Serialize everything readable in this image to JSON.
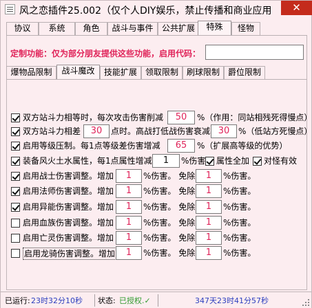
{
  "window": {
    "title": "风之恋插件25.002（仅个人DIY娱乐，禁止传播和商业应用",
    "close_glyph": "✕"
  },
  "tabs_top": [
    {
      "label": "协议"
    },
    {
      "label": "系统"
    },
    {
      "label": "角色"
    },
    {
      "label": "战斗与事件"
    },
    {
      "label": "公共扩展"
    },
    {
      "label": "特殊"
    },
    {
      "label": "怪物"
    }
  ],
  "custom": {
    "label": "定制功能：仅为部分朋友提供这些功能，启用代码：",
    "code_value": ""
  },
  "tabs_sub": [
    {
      "label": "爆物品限制"
    },
    {
      "label": "战斗魔改"
    },
    {
      "label": "技能扩展"
    },
    {
      "label": "领取限制"
    },
    {
      "label": "刷球限制"
    },
    {
      "label": "爵位限制"
    }
  ],
  "rows": {
    "r1": {
      "a": "双方站斗力相等时，每次攻击伤害削减",
      "v": "50",
      "b": "%（作用：同站相残死得慢点）"
    },
    "r2": {
      "a": "双方站斗力相差",
      "v1": "30",
      "b": "点时。高战打低战伤害衰减",
      "v2": "30",
      "c": "%（低站方死慢点）"
    },
    "r3": {
      "a": "启用等级压制。每1点等级差伤害增减",
      "v": "65",
      "b": "%（扩展高等级的优势）"
    },
    "r4": {
      "a": "装备风火土水属性，每1点属性增减",
      "v": "1",
      "b": "%伤害",
      "c": "属性全加",
      "d": "对怪有效"
    },
    "r5": {
      "a": "启用战士伤害调整。增加",
      "v1": "1",
      "b": "%伤害。  免除",
      "v2": "1",
      "c": "%伤害。"
    },
    "r6": {
      "a": "启用法师伤害调整。增加",
      "v1": "1",
      "b": "%伤害。  免除",
      "v2": "1",
      "c": "%伤害。"
    },
    "r7": {
      "a": "启用异能伤害调整。增加",
      "v1": "1",
      "b": "%伤害。  免除",
      "v2": "1",
      "c": "%伤害。"
    },
    "r8": {
      "a": "启用血族伤害调整。增加",
      "v1": "1",
      "b": "%伤害。  免除",
      "v2": "1",
      "c": "%伤害。"
    },
    "r9": {
      "a": "启用亡灵伤害调整。增加",
      "v1": "1",
      "b": "%伤害。  免除",
      "v2": "1",
      "c": "%伤害。"
    },
    "r10": {
      "a": "启用龙骑伤害调整。增加",
      "v1": "1",
      "b": "%伤害。  免除",
      "v2": "1",
      "c": "%伤害。"
    }
  },
  "status": {
    "run_label": "已运行:",
    "run_value": "23时32分10秒",
    "state_label": "状态:",
    "state_value": "已授权.✓",
    "remaining": "347天23时41分57秒"
  }
}
